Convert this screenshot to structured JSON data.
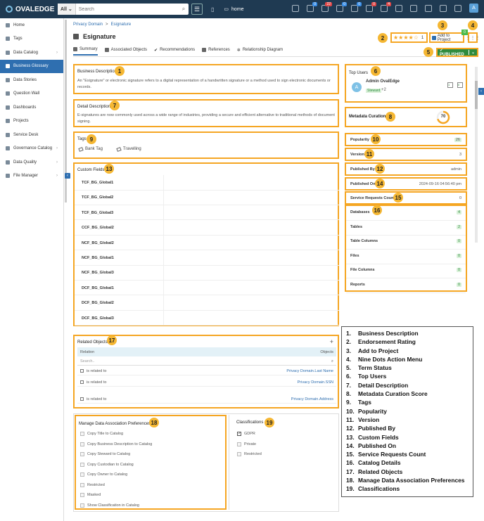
{
  "app": {
    "logo_text": "OVALEDGE"
  },
  "search": {
    "scope": "All",
    "placeholder": "Search"
  },
  "topnav": {
    "home_label": "home",
    "badges": [
      "0",
      "22",
      "0",
      "0",
      "0",
      "4"
    ],
    "avatar": "A"
  },
  "sidebar": {
    "items": [
      {
        "label": "Home",
        "chev": ""
      },
      {
        "label": "Tags",
        "chev": ""
      },
      {
        "label": "Data Catalog",
        "chev": "›"
      },
      {
        "label": "Business Glossary",
        "chev": "",
        "active": true
      },
      {
        "label": "Data Stories",
        "chev": ""
      },
      {
        "label": "Question Wall",
        "chev": ""
      },
      {
        "label": "Dashboards",
        "chev": ""
      },
      {
        "label": "Projects",
        "chev": ""
      },
      {
        "label": "Service Desk",
        "chev": ""
      },
      {
        "label": "Governance Catalog",
        "chev": "›"
      },
      {
        "label": "Data Quality",
        "chev": "›"
      },
      {
        "label": "File Manager",
        "chev": "›"
      }
    ]
  },
  "breadcrumb": {
    "root": "Privacy Domain",
    "sep": ">",
    "current": "Esignature"
  },
  "page": {
    "title": "Esignature"
  },
  "tabs": [
    "Summary",
    "Associated Objects",
    "Recommendations",
    "References",
    "Relationship Diagram"
  ],
  "rating": {
    "stars": "★★★★☆",
    "count": "1"
  },
  "add_project": {
    "label": "Add to Project",
    "badge": "0"
  },
  "nine_dots": {
    "glyph": "⋮⋮⋮"
  },
  "status": {
    "label": "✓ PUBLISHED",
    "dropdown": "⌄"
  },
  "business_description": {
    "title": "Business Description",
    "text": "An \"Esignature\" or electronic signature refers to a digital representation of a handwritten signature or a method used to sign electronic documents or records."
  },
  "detail_description": {
    "title": "Detail Description",
    "text": "E-signatures are now commonly used across a wide range of industries, providing a secure and efficient alternative to traditional methods of document signing."
  },
  "tags": {
    "title": "Tags",
    "items": [
      "Bank Tag",
      "Travelling"
    ]
  },
  "custom_fields": {
    "title": "Custom Fields",
    "rows": [
      "TCF_BG_Global1",
      "TCF_BG_Global2",
      "TCF_BG_Global3",
      "CCF_BG_Global2",
      "NCF_BG_Global2",
      "NCF_BG_Global1",
      "NCF_BG_Global3",
      "DCF_BG_Global1",
      "DCF_BG_Global2",
      "DCF_BG_Global3"
    ]
  },
  "related_objects": {
    "title": "Related Objects",
    "add": "+",
    "col_relation": "Relation",
    "col_objects": "Objects",
    "search_placeholder": "Search..",
    "rows": [
      {
        "relation": "is related to",
        "object": "Privacy Domain.Last Name"
      },
      {
        "relation": "is related to",
        "object": "Privacy Domain.SSN"
      },
      {
        "relation": "is related to",
        "object": "Privacy Domain.Address"
      }
    ]
  },
  "mdap": {
    "title": "Manage Data Association Preferences",
    "items": [
      "Copy Title to Catalog",
      "Copy Business Description to Catalog",
      "Copy Steward to Catalog",
      "Copy Custodian to Catalog",
      "Copy Owner to Catalog",
      "Restricted",
      "Masked",
      "Show Classification in Catalog"
    ]
  },
  "classifications": {
    "title": "Classifications",
    "items": [
      {
        "label": "GDPR",
        "checked": true
      },
      {
        "label": "Private",
        "checked": false
      },
      {
        "label": "Restricted",
        "checked": false
      }
    ]
  },
  "top_users": {
    "title": "Top Users",
    "user_name": "Admin OvalEdge",
    "avatar": "A",
    "role": "Steward",
    "more": "+2",
    "icon_counts": [
      "1",
      "0"
    ]
  },
  "metadata_curation": {
    "label": "Metadata Curation",
    "score": "70",
    "score_value": 70
  },
  "stats": [
    {
      "label": "Popularity",
      "value": "26",
      "badge": true
    },
    {
      "label": "Version",
      "value": "3",
      "badge": false
    },
    {
      "label": "Published By",
      "value": "admin",
      "badge": false
    },
    {
      "label": "Published On",
      "value": "2024-09-16 04:56:40 pm",
      "badge": false
    },
    {
      "label": "Service Requests Count",
      "value": "0",
      "badge": false
    }
  ],
  "catalog": [
    {
      "label": "Databases",
      "value": "4"
    },
    {
      "label": "Tables",
      "value": "2"
    },
    {
      "label": "Table Columns",
      "value": "0"
    },
    {
      "label": "Files",
      "value": "0"
    },
    {
      "label": "File Columns",
      "value": "0"
    },
    {
      "label": "Reports",
      "value": "0"
    }
  ],
  "callouts": [
    "1",
    "2",
    "3",
    "4",
    "5",
    "6",
    "7",
    "8",
    "9",
    "10",
    "11",
    "12",
    "13",
    "14",
    "15",
    "16",
    "17",
    "18",
    "19"
  ],
  "legend": [
    {
      "n": "1.",
      "t": "Business Description"
    },
    {
      "n": "2.",
      "t": "Endorsement Rating"
    },
    {
      "n": "3.",
      "t": "Add to Project"
    },
    {
      "n": "4.",
      "t": "Nine Dots Action Menu"
    },
    {
      "n": "5.",
      "t": "Term Status"
    },
    {
      "n": "6.",
      "t": "Top Users"
    },
    {
      "n": "7.",
      "t": "Detail Description"
    },
    {
      "n": "8.",
      "t": "Metadata Curation Score"
    },
    {
      "n": "9.",
      "t": "Tags"
    },
    {
      "n": "10.",
      "t": "Popularity"
    },
    {
      "n": "11.",
      "t": "Version"
    },
    {
      "n": "12.",
      "t": "Published By"
    },
    {
      "n": "13.",
      "t": "Custom Fields"
    },
    {
      "n": "14.",
      "t": "Published On"
    },
    {
      "n": "15.",
      "t": "Service Requests Count"
    },
    {
      "n": "16.",
      "t": "Catalog Details"
    },
    {
      "n": "17.",
      "t": "Related Objects"
    },
    {
      "n": "18.",
      "t": "Manage Data Association Preferences"
    },
    {
      "n": "19.",
      "t": "Classifications"
    }
  ]
}
